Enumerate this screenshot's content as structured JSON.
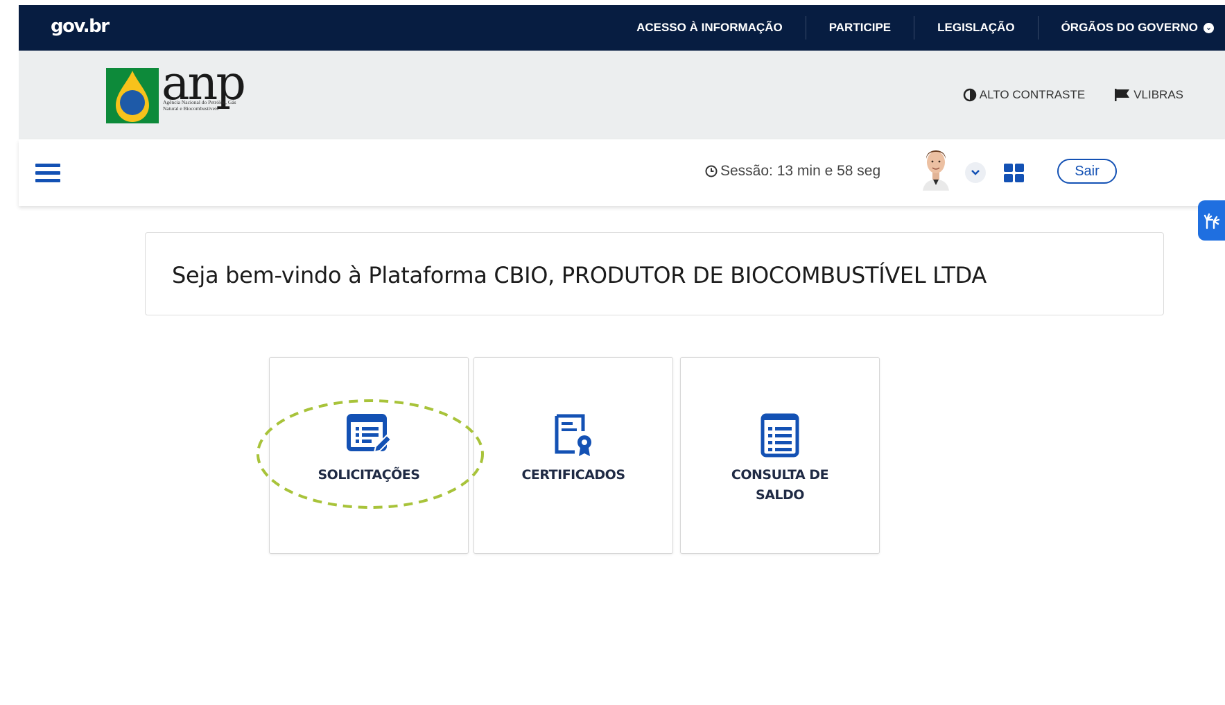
{
  "govbar": {
    "logo": "gov.br",
    "nav": [
      {
        "label": "ACESSO À INFORMAÇÃO"
      },
      {
        "label": "PARTICIPE"
      },
      {
        "label": "LEGISLAÇÃO"
      },
      {
        "label": "ÓRGÃOS DO GOVERNO"
      }
    ],
    "background": "#071d41"
  },
  "header": {
    "logo_text": "anp",
    "logo_subtitle": "Agência Nacional do Petróleo, Gás Natural e Biocombustíveis",
    "accessibility": {
      "contrast_label": "ALTO CONTRASTE",
      "vlibras_label": "VLIBRAS"
    }
  },
  "session_bar": {
    "session_text": "Sessão: 13 min e 58 seg",
    "logout_label": "Sair",
    "icons": [
      "menu-icon",
      "clock-icon",
      "avatar",
      "chevron-down-icon",
      "apps-grid-icon",
      "sign-language-icon"
    ],
    "accent": "#1351b4"
  },
  "welcome": {
    "title": "Seja bem-vindo à Plataforma CBIO, PRODUTOR DE BIOCOMBUSTÍVEL LTDA"
  },
  "tiles": [
    {
      "label": "SOLICITAÇÕES",
      "icon": "request-list-edit-icon",
      "highlighted": true
    },
    {
      "label": "CERTIFICADOS",
      "icon": "certificate-icon",
      "highlighted": false
    },
    {
      "label": "CONSULTA DE SALDO",
      "icon": "balance-document-icon",
      "highlighted": false
    }
  ],
  "colors": {
    "icon_blue": "#1351b4",
    "highlight_green": "#a8c33a",
    "header_gray": "#eceeef"
  }
}
